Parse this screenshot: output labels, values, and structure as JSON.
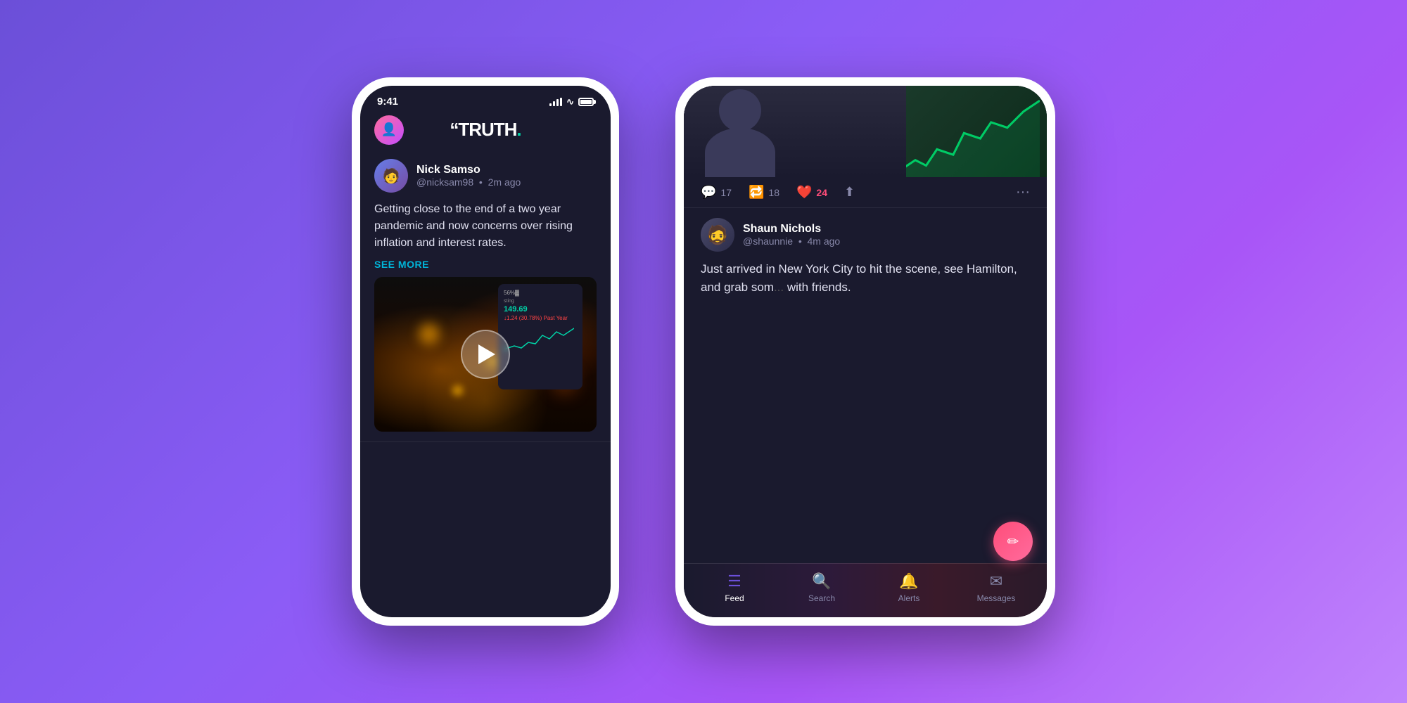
{
  "background": "#7b5ea7",
  "phone1": {
    "status_time": "9:41",
    "app_title": "TRUTH.",
    "logo_dot": ".",
    "post": {
      "user_name": "Nick Samso",
      "user_handle": "@nicksam98",
      "time_ago": "2m ago",
      "text": "Getting close to the end of a two year pandemic and now concerns over rising inflation and interest rates.",
      "see_more": "SEE MORE"
    }
  },
  "phone2": {
    "post_top": {
      "comments_count": "17",
      "retruth_count": "18",
      "likes_count": "24"
    },
    "post": {
      "user_name": "Shaun Nichols",
      "user_handle": "@shaunnie",
      "time_ago": "4m ago",
      "text": "Just arrived in New York City to hit the scene, see Hamilton, and grab som... with friends."
    }
  },
  "nav": {
    "feed_label": "Feed",
    "search_label": "Search",
    "alerts_label": "Alerts",
    "messages_label": "Messages"
  },
  "colors": {
    "accent_teal": "#00d4a8",
    "accent_purple": "#6b4fd8",
    "accent_pink": "#ff4d79",
    "heart": "#ff4d79",
    "text_secondary": "#8888aa"
  }
}
